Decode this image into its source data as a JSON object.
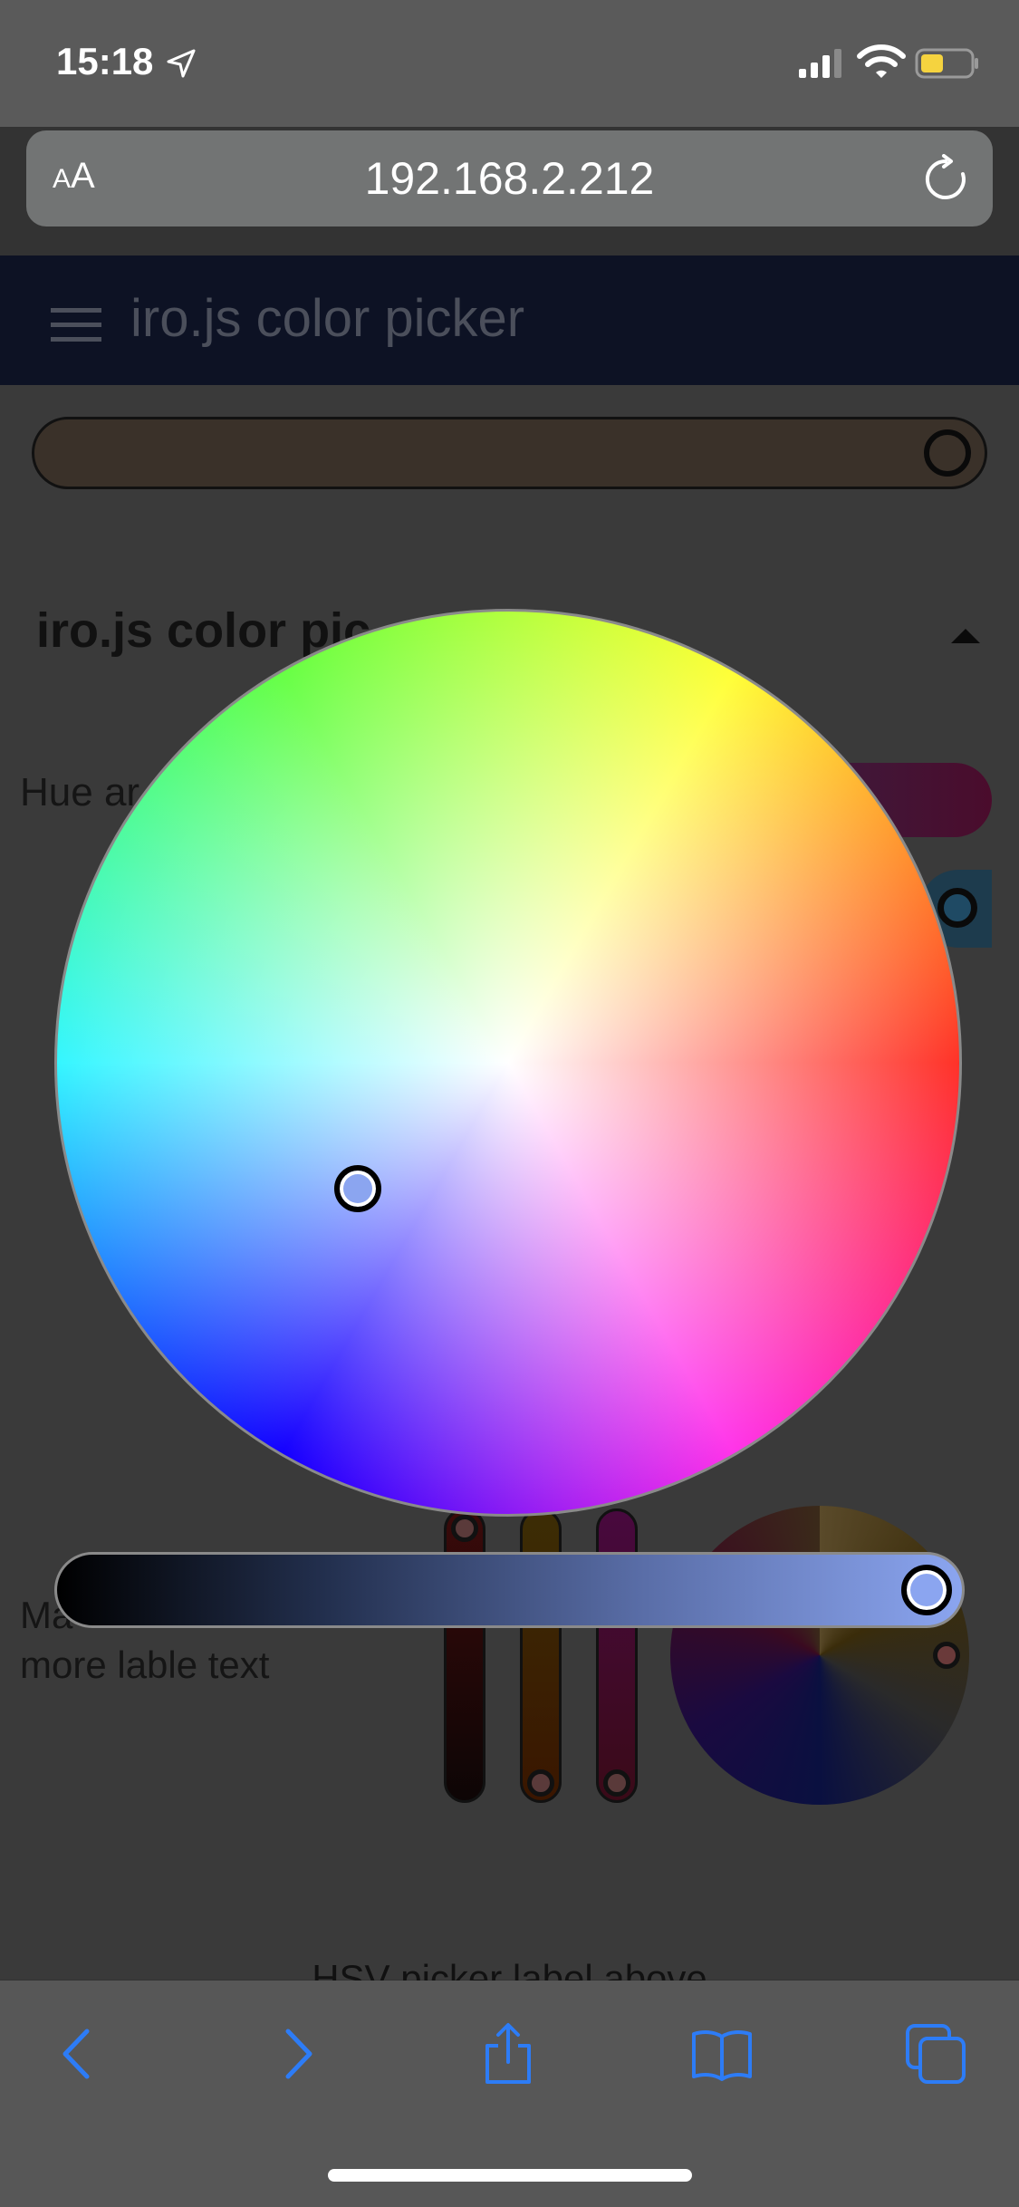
{
  "status_bar": {
    "time": "15:18",
    "icons": [
      "location-arrow-icon",
      "cellular-signal-icon",
      "wifi-icon",
      "battery-icon"
    ],
    "battery_color": "#f5d33f"
  },
  "address_bar": {
    "text_size_label_small": "A",
    "text_size_label_large": "A",
    "url": "192.168.2.212",
    "reload_icon": "reload-icon"
  },
  "page": {
    "header_title": "iro.js color picker",
    "section_heading": "iro.js color pic",
    "hue_label": "Hue ar",
    "many_label": "Ma",
    "many_label_line2": "more lable text",
    "hsv_label": "HSV picker label above"
  },
  "color_picker": {
    "selected_color": "#8ba5f0",
    "value_slider_level_percent": 100
  },
  "toolbar": {
    "icons": [
      "back-icon",
      "forward-icon",
      "share-icon",
      "bookmarks-icon",
      "tabs-icon"
    ],
    "accent": "#2d7cf6"
  }
}
